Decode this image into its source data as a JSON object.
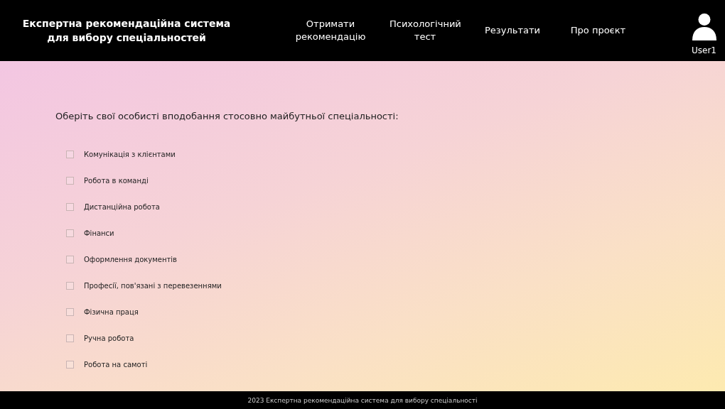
{
  "header": {
    "title": "Експертна рекомендаційна система для вибору спеціальностей",
    "nav": [
      {
        "label": "Отримати рекомендацію"
      },
      {
        "label": "Психологічний тест"
      },
      {
        "label": "Результати"
      },
      {
        "label": "Про проєкт"
      }
    ],
    "user": {
      "name": "User1"
    }
  },
  "question": "Оберіть свої особисті вподобання стосовно майбутньої спеціальності:",
  "options": [
    {
      "label": "Комунікація з клієнтами",
      "checked": false
    },
    {
      "label": "Робота в команді",
      "checked": false
    },
    {
      "label": "Дистанційна робота",
      "checked": false
    },
    {
      "label": "Фінанси",
      "checked": false
    },
    {
      "label": "Оформлення документів",
      "checked": false
    },
    {
      "label": "Професії, пов'язані з перевезеннями",
      "checked": false
    },
    {
      "label": "Фізична праця",
      "checked": false
    },
    {
      "label": "Ручна робота",
      "checked": false
    },
    {
      "label": "Робота на самоті",
      "checked": false
    }
  ],
  "footer": "2023 Експертна рекомендаційна система для вибору спеціальності"
}
